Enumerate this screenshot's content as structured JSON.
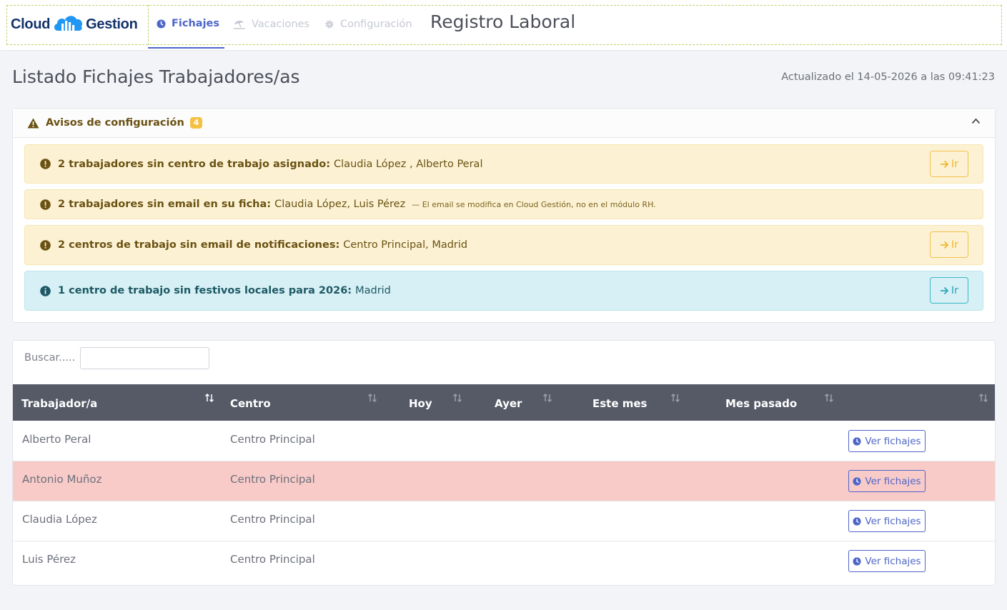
{
  "brand": {
    "logo_left": "Cloud",
    "logo_right": "Gestion",
    "logo_color": "#14336b",
    "accent_color": "#2196f3"
  },
  "nav": {
    "items": [
      {
        "label": "Fichajes",
        "icon": "clock-icon",
        "active": true
      },
      {
        "label": "Vacaciones",
        "icon": "beach-umbrella-icon",
        "active": false
      },
      {
        "label": "Configuración",
        "icon": "gear-icon",
        "active": false
      }
    ],
    "app_title": "Registro Laboral"
  },
  "page": {
    "title": "Listado Fichajes Trabajadores/as",
    "updated": "Actualizado el 14-05-2026 a las 09:41:23"
  },
  "warnings": {
    "title": "Avisos de configuración",
    "count": "4",
    "alerts": [
      {
        "type": "warning",
        "bold": "2 trabajadores sin centro de trabajo asignado:",
        "text": "Claudia López , Alberto Peral",
        "note": "",
        "button": "Ir"
      },
      {
        "type": "warning",
        "bold": "2 trabajadores sin email en su ficha:",
        "text": "Claudia López, Luis Pérez",
        "note": "— El email se modifica en Cloud Gestión, no en el módulo RH.",
        "button": ""
      },
      {
        "type": "warning",
        "bold": "2 centros de trabajo sin email de notificaciones:",
        "text": "Centro Principal, Madrid",
        "note": "",
        "button": "Ir"
      },
      {
        "type": "info",
        "bold": "1 centro de trabajo sin festivos locales para 2026:",
        "text": "Madrid",
        "note": "",
        "button": "Ir"
      }
    ]
  },
  "table": {
    "search_label": "Buscar.....",
    "search_value": "",
    "columns": [
      "Trabajador/a",
      "Centro",
      "Hoy",
      "Ayer",
      "Este mes",
      "Mes pasado",
      ""
    ],
    "rows": [
      {
        "worker": "Alberto Peral",
        "center": "Centro Principal",
        "today": "",
        "yesterday": "",
        "this_month": "",
        "last_month": "",
        "action": "Ver fichajes",
        "highlight": false
      },
      {
        "worker": "Antonio Muñoz",
        "center": "Centro Principal",
        "today": "",
        "yesterday": "",
        "this_month": "",
        "last_month": "",
        "action": "Ver fichajes",
        "highlight": true
      },
      {
        "worker": "Claudia López",
        "center": "Centro Principal",
        "today": "",
        "yesterday": "",
        "this_month": "",
        "last_month": "",
        "action": "Ver fichajes",
        "highlight": false
      },
      {
        "worker": "Luis Pérez",
        "center": "Centro Principal",
        "today": "",
        "yesterday": "",
        "this_month": "",
        "last_month": "",
        "action": "Ver fichajes",
        "highlight": false
      }
    ]
  },
  "colors": {
    "primary": "#4e66c9",
    "warning_bg": "#fcf2d3",
    "info_bg": "#d6f0f5",
    "danger_row": "#f8cbc9",
    "table_header": "#565a67"
  }
}
